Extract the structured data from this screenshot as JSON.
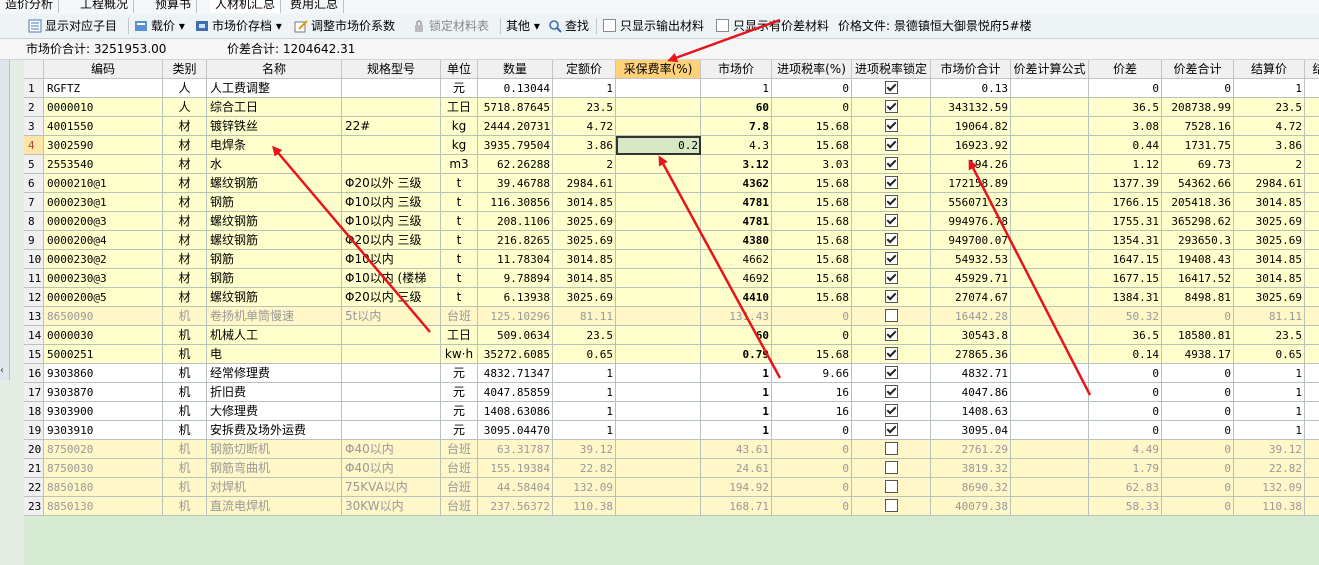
{
  "tabs": [
    "造价分析",
    "工程概况",
    "预算书",
    "人材机汇总",
    "费用汇总"
  ],
  "toolbar": {
    "show_sub": "显示对应子目",
    "price": "载价",
    "market_archive": "市场价存档",
    "adjust_coef": "调整市场价系数",
    "lock_table": "锁定材料表",
    "other": "其他",
    "find": "查找",
    "only_output": "只显示输出材料",
    "only_diff": "只显示有价差材料",
    "price_file_label": "价格文件:",
    "price_file_value": "景德镇恒大御景悦府5#楼"
  },
  "summary": {
    "market_label": "市场价合计:",
    "market_value": "3251953.00",
    "diff_label": "价差合计:",
    "diff_value": "1204642.31"
  },
  "headers": [
    "编码",
    "类别",
    "名称",
    "规格型号",
    "单位",
    "数量",
    "定额价",
    "采保费率(%)",
    "市场价",
    "进项税率(%)",
    "进项税率锁定",
    "市场价合计",
    "价差计算公式",
    "价差",
    "价差合计",
    "结算价",
    "结算"
  ],
  "rows": [
    {
      "n": "1",
      "code": "RGFTZ",
      "cat": "人",
      "name": "人工费调整",
      "spec": "",
      "unit": "元",
      "qty": "0.13044",
      "base": "1",
      "rate": "",
      "market": "1",
      "tax": "0",
      "lock": true,
      "total": "0.13",
      "formula": "",
      "diff": "0",
      "difftot": "0",
      "settle": "1",
      "bg": "#ffffff",
      "gray": false,
      "bold": false
    },
    {
      "n": "2",
      "code": "0000010",
      "cat": "人",
      "name": "综合工日",
      "spec": "",
      "unit": "工日",
      "qty": "5718.87645",
      "base": "23.5",
      "rate": "",
      "market": "60",
      "tax": "0",
      "lock": true,
      "total": "343132.59",
      "formula": "",
      "diff": "36.5",
      "difftot": "208738.99",
      "settle": "23.5",
      "bg": "#ffffcc",
      "gray": false,
      "bold": true
    },
    {
      "n": "3",
      "code": "4001550",
      "cat": "材",
      "name": "镀锌铁丝",
      "spec": "22#",
      "unit": "kg",
      "qty": "2444.20731",
      "base": "4.72",
      "rate": "",
      "market": "7.8",
      "tax": "15.68",
      "lock": true,
      "total": "19064.82",
      "formula": "",
      "diff": "3.08",
      "difftot": "7528.16",
      "settle": "4.72",
      "bg": "#ffffcc",
      "gray": false,
      "bold": true
    },
    {
      "n": "4",
      "code": "3002590",
      "cat": "材",
      "name": "电焊条",
      "spec": "",
      "unit": "kg",
      "qty": "3935.79504",
      "base": "3.86",
      "rate": "0.2",
      "market": "4.3",
      "tax": "15.68",
      "lock": true,
      "total": "16923.92",
      "formula": "",
      "diff": "0.44",
      "difftot": "1731.75",
      "settle": "3.86",
      "bg": "#ffffcc",
      "gray": false,
      "bold": false,
      "selected": true
    },
    {
      "n": "5",
      "code": "2553540",
      "cat": "材",
      "name": "水",
      "spec": "",
      "unit": "m3",
      "qty": "62.26288",
      "base": "2",
      "rate": "",
      "market": "3.12",
      "tax": "3.03",
      "lock": true,
      "total": "194.26",
      "formula": "",
      "diff": "1.12",
      "difftot": "69.73",
      "settle": "2",
      "bg": "#ffffcc",
      "gray": false,
      "bold": true
    },
    {
      "n": "6",
      "code": "0000210@1",
      "cat": "材",
      "name": "螺纹钢筋",
      "spec": "Φ20以外 三级",
      "unit": "t",
      "qty": "39.46788",
      "base": "2984.61",
      "rate": "",
      "market": "4362",
      "tax": "15.68",
      "lock": true,
      "total": "172158.89",
      "formula": "",
      "diff": "1377.39",
      "difftot": "54362.66",
      "settle": "2984.61",
      "bg": "#ffffcc",
      "gray": false,
      "bold": true
    },
    {
      "n": "7",
      "code": "0000230@1",
      "cat": "材",
      "name": "钢筋",
      "spec": "Φ10以内 三级",
      "unit": "t",
      "qty": "116.30856",
      "base": "3014.85",
      "rate": "",
      "market": "4781",
      "tax": "15.68",
      "lock": true,
      "total": "556071.23",
      "formula": "",
      "diff": "1766.15",
      "difftot": "205418.36",
      "settle": "3014.85",
      "bg": "#ffffcc",
      "gray": false,
      "bold": true
    },
    {
      "n": "8",
      "code": "0000200@3",
      "cat": "材",
      "name": "螺纹钢筋",
      "spec": "Φ10以内 三级",
      "unit": "t",
      "qty": "208.1106",
      "base": "3025.69",
      "rate": "",
      "market": "4781",
      "tax": "15.68",
      "lock": true,
      "total": "994976.78",
      "formula": "",
      "diff": "1755.31",
      "difftot": "365298.62",
      "settle": "3025.69",
      "bg": "#ffffcc",
      "gray": false,
      "bold": true
    },
    {
      "n": "9",
      "code": "0000200@4",
      "cat": "材",
      "name": "螺纹钢筋",
      "spec": "Φ20以内 三级",
      "unit": "t",
      "qty": "216.8265",
      "base": "3025.69",
      "rate": "",
      "market": "4380",
      "tax": "15.68",
      "lock": true,
      "total": "949700.07",
      "formula": "",
      "diff": "1354.31",
      "difftot": "293650.3",
      "settle": "3025.69",
      "bg": "#ffffcc",
      "gray": false,
      "bold": true
    },
    {
      "n": "10",
      "code": "0000230@2",
      "cat": "材",
      "name": "钢筋",
      "spec": "Φ10以内",
      "unit": "t",
      "qty": "11.78304",
      "base": "3014.85",
      "rate": "",
      "market": "4662",
      "tax": "15.68",
      "lock": true,
      "total": "54932.53",
      "formula": "",
      "diff": "1647.15",
      "difftot": "19408.43",
      "settle": "3014.85",
      "bg": "#ffffcc",
      "gray": false,
      "bold": false
    },
    {
      "n": "11",
      "code": "0000230@3",
      "cat": "材",
      "name": "钢筋",
      "spec": "Φ10以内 (楼梯",
      "unit": "t",
      "qty": "9.78894",
      "base": "3014.85",
      "rate": "",
      "market": "4692",
      "tax": "15.68",
      "lock": true,
      "total": "45929.71",
      "formula": "",
      "diff": "1677.15",
      "difftot": "16417.52",
      "settle": "3014.85",
      "bg": "#ffffcc",
      "gray": false,
      "bold": false
    },
    {
      "n": "12",
      "code": "0000200@5",
      "cat": "材",
      "name": "螺纹钢筋",
      "spec": "Φ20以内 三级",
      "unit": "t",
      "qty": "6.13938",
      "base": "3025.69",
      "rate": "",
      "market": "4410",
      "tax": "15.68",
      "lock": true,
      "total": "27074.67",
      "formula": "",
      "diff": "1384.31",
      "difftot": "8498.81",
      "settle": "3025.69",
      "bg": "#ffffcc",
      "gray": false,
      "bold": true
    },
    {
      "n": "13",
      "code": "8650090",
      "cat": "机",
      "name": "卷扬机单筒慢速",
      "spec": "5t以内",
      "unit": "台班",
      "qty": "125.10296",
      "base": "81.11",
      "rate": "",
      "market": "131.43",
      "tax": "0",
      "lock": false,
      "total": "16442.28",
      "formula": "",
      "diff": "50.32",
      "difftot": "0",
      "settle": "81.11",
      "bg": "#fff7c8",
      "gray": true,
      "bold": false
    },
    {
      "n": "14",
      "code": "0000030",
      "cat": "机",
      "name": "机械人工",
      "spec": "",
      "unit": "工日",
      "qty": "509.0634",
      "base": "23.5",
      "rate": "",
      "market": "60",
      "tax": "0",
      "lock": true,
      "total": "30543.8",
      "formula": "",
      "diff": "36.5",
      "difftot": "18580.81",
      "settle": "23.5",
      "bg": "#ffffcc",
      "gray": false,
      "bold": true
    },
    {
      "n": "15",
      "code": "5000251",
      "cat": "机",
      "name": "电",
      "spec": "",
      "unit": "kw·h",
      "qty": "35272.6085",
      "base": "0.65",
      "rate": "",
      "market": "0.79",
      "tax": "15.68",
      "lock": true,
      "total": "27865.36",
      "formula": "",
      "diff": "0.14",
      "difftot": "4938.17",
      "settle": "0.65",
      "bg": "#ffffcc",
      "gray": false,
      "bold": true
    },
    {
      "n": "16",
      "code": "9303860",
      "cat": "机",
      "name": "经常修理费",
      "spec": "",
      "unit": "元",
      "qty": "4832.71347",
      "base": "1",
      "rate": "",
      "market": "1",
      "tax": "9.66",
      "lock": true,
      "total": "4832.71",
      "formula": "",
      "diff": "0",
      "difftot": "0",
      "settle": "1",
      "bg": "#ffffff",
      "gray": false,
      "bold": true
    },
    {
      "n": "17",
      "code": "9303870",
      "cat": "机",
      "name": "折旧费",
      "spec": "",
      "unit": "元",
      "qty": "4047.85859",
      "base": "1",
      "rate": "",
      "market": "1",
      "tax": "16",
      "lock": true,
      "total": "4047.86",
      "formula": "",
      "diff": "0",
      "difftot": "0",
      "settle": "1",
      "bg": "#ffffff",
      "gray": false,
      "bold": true
    },
    {
      "n": "18",
      "code": "9303900",
      "cat": "机",
      "name": "大修理费",
      "spec": "",
      "unit": "元",
      "qty": "1408.63086",
      "base": "1",
      "rate": "",
      "market": "1",
      "tax": "16",
      "lock": true,
      "total": "1408.63",
      "formula": "",
      "diff": "0",
      "difftot": "0",
      "settle": "1",
      "bg": "#ffffff",
      "gray": false,
      "bold": true
    },
    {
      "n": "19",
      "code": "9303910",
      "cat": "机",
      "name": "安拆费及场外运费",
      "spec": "",
      "unit": "元",
      "qty": "3095.04470",
      "base": "1",
      "rate": "",
      "market": "1",
      "tax": "0",
      "lock": true,
      "total": "3095.04",
      "formula": "",
      "diff": "0",
      "difftot": "0",
      "settle": "1",
      "bg": "#ffffff",
      "gray": false,
      "bold": true
    },
    {
      "n": "20",
      "code": "8750020",
      "cat": "机",
      "name": "钢筋切断机",
      "spec": "Φ40以内",
      "unit": "台班",
      "qty": "63.31787",
      "base": "39.12",
      "rate": "",
      "market": "43.61",
      "tax": "0",
      "lock": false,
      "total": "2761.29",
      "formula": "",
      "diff": "4.49",
      "difftot": "0",
      "settle": "39.12",
      "bg": "#fff7c8",
      "gray": true,
      "bold": false
    },
    {
      "n": "21",
      "code": "8750030",
      "cat": "机",
      "name": "钢筋弯曲机",
      "spec": "Φ40以内",
      "unit": "台班",
      "qty": "155.19384",
      "base": "22.82",
      "rate": "",
      "market": "24.61",
      "tax": "0",
      "lock": false,
      "total": "3819.32",
      "formula": "",
      "diff": "1.79",
      "difftot": "0",
      "settle": "22.82",
      "bg": "#fff7c8",
      "gray": true,
      "bold": false
    },
    {
      "n": "22",
      "code": "8850180",
      "cat": "机",
      "name": "对焊机",
      "spec": "75KVA以内",
      "unit": "台班",
      "qty": "44.58404",
      "base": "132.09",
      "rate": "",
      "market": "194.92",
      "tax": "0",
      "lock": false,
      "total": "8690.32",
      "formula": "",
      "diff": "62.83",
      "difftot": "0",
      "settle": "132.09",
      "bg": "#fff7c8",
      "gray": true,
      "bold": false
    },
    {
      "n": "23",
      "code": "8850130",
      "cat": "机",
      "name": "直流电焊机",
      "spec": "30KW以内",
      "unit": "台班",
      "qty": "237.56372",
      "base": "110.38",
      "rate": "",
      "market": "168.71",
      "tax": "0",
      "lock": false,
      "total": "40079.38",
      "formula": "",
      "diff": "58.33",
      "difftot": "0",
      "settle": "110.38",
      "bg": "#fff7c8",
      "gray": true,
      "bold": false
    }
  ],
  "colors": {
    "annotation": "#e8141c",
    "highlight_header": "#ffd27a",
    "selected_cell": "#d6e8c4"
  }
}
